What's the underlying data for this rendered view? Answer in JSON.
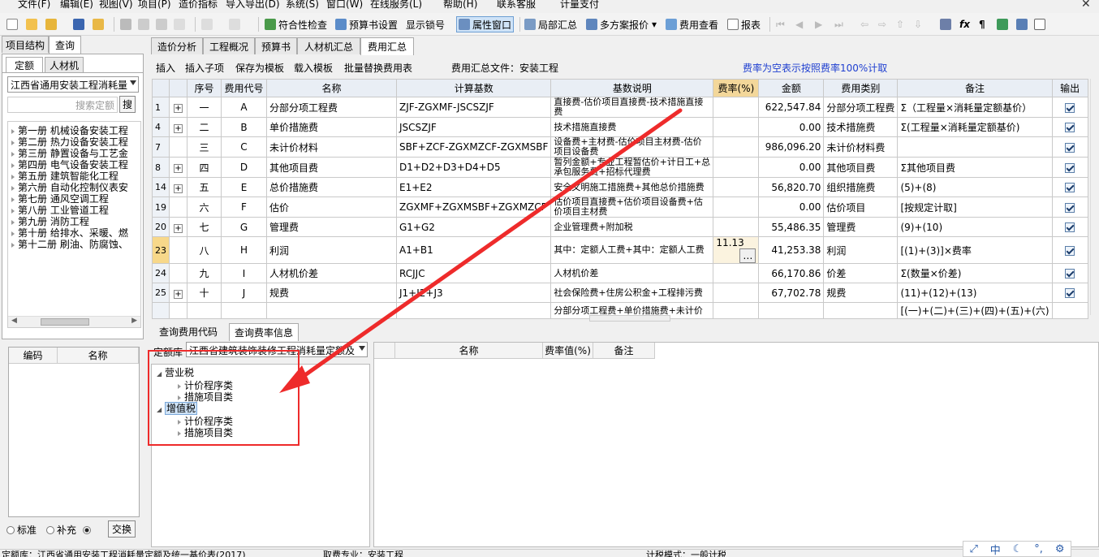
{
  "menu": [
    "文件(F)",
    "编辑(E)",
    "视图(V)",
    "项目(P)",
    "造价指标",
    "导入导出(D)",
    "系统(S)",
    "窗口(W)",
    "在线服务(L)",
    "帮助(H)",
    "联系客服",
    "计量支付"
  ],
  "toolbar": {
    "check": "符合性检查",
    "budget_settings": "预算书设置",
    "show_lock": "显示锁号",
    "property_window": "属性窗口",
    "local_summary": "局部汇总",
    "multi_quote": "多方案报价",
    "fee_view": "费用查看",
    "report": "报表"
  },
  "left": {
    "tabs": [
      "项目结构",
      "查询"
    ],
    "subtabs": [
      "定额",
      "人材机"
    ],
    "library": "江西省通用安装工程消耗量",
    "search_placeholder": "搜索定额",
    "search_btn": "搜",
    "volumes": [
      "第一册 机械设备安装工程",
      "第二册 热力设备安装工程",
      "第三册 静置设备与工艺金",
      "第四册 电气设备安装工程",
      "第五册 建筑智能化工程",
      "第六册 自动化控制仪表安",
      "第七册 通风空调工程",
      "第八册 工业管道工程",
      "第九册 消防工程",
      "第十册 给排水、采暖、燃",
      "第十二册 刷油、防腐蚀、"
    ],
    "grid_headers": [
      "编码",
      "名称"
    ],
    "radios": [
      "标准",
      "补充"
    ],
    "swap_btn": "交换"
  },
  "main": {
    "tabs": [
      "造价分析",
      "工程概况",
      "预算书",
      "人材机汇总",
      "费用汇总"
    ],
    "active_tab": "费用汇总",
    "subtoolbar": {
      "insert": "插入",
      "insert_child": "插入子项",
      "save_template": "保存为模板",
      "load_template": "载入模板",
      "batch_replace": "批量替换费用表",
      "file_label": "费用汇总文件：安装工程",
      "note": "费率为空表示按照费率100%计取"
    },
    "headers": [
      "序号",
      "费用代号",
      "名称",
      "计算基数",
      "基数说明",
      "费率(%)",
      "金额",
      "费用类别",
      "备注",
      "输出"
    ],
    "rows": [
      {
        "ln": "1",
        "exp": "+",
        "seq": "一",
        "code": "A",
        "name": "分部分项工程费",
        "base": "ZJF-ZGXMF-JSCSZJF",
        "desc": "直接费-估价项目直接费-技术措施直接费",
        "rate": "",
        "amount": "622,547.84",
        "cat": "分部分项工程费",
        "note": "Σ（工程量×消耗量定额基价）"
      },
      {
        "ln": "4",
        "exp": "+",
        "seq": "二",
        "code": "B",
        "name": "单价措施费",
        "base": "JSCSZJF",
        "desc": "技术措施直接费",
        "rate": "",
        "amount": "0.00",
        "cat": "技术措施费",
        "note": "Σ(工程量×消耗量定额基价)"
      },
      {
        "ln": "7",
        "exp": "",
        "seq": "三",
        "code": "C",
        "name": "未计价材料",
        "base": "SBF+ZCF-ZGXMZCF-ZGXMSBF",
        "desc": "设备费+主材费-估价项目主材费-估价项目设备费",
        "rate": "",
        "amount": "986,096.20",
        "cat": "未计价材料费",
        "note": ""
      },
      {
        "ln": "8",
        "exp": "+",
        "seq": "四",
        "code": "D",
        "name": "其他项目费",
        "base": "D1+D2+D3+D4+D5",
        "desc": "暂列金额+专业工程暂估价+计日工+总承包服务费+招标代理费",
        "rate": "",
        "amount": "0.00",
        "cat": "其他项目费",
        "note": "Σ其他项目费"
      },
      {
        "ln": "14",
        "exp": "+",
        "seq": "五",
        "code": "E",
        "name": "总价措施费",
        "base": "E1+E2",
        "desc": "安全文明施工措施费+其他总价措施费",
        "rate": "",
        "amount": "56,820.70",
        "cat": "组织措施费",
        "note": "(5)+(8)"
      },
      {
        "ln": "19",
        "exp": "",
        "seq": "六",
        "code": "F",
        "name": "估价",
        "base": "ZGXMF+ZGXMSBF+ZGXMZCF",
        "desc": "估价项目直接费+估价项目设备费+估价项目主材费",
        "rate": "",
        "amount": "0.00",
        "cat": "估价项目",
        "note": "[按规定计取]"
      },
      {
        "ln": "20",
        "exp": "+",
        "seq": "七",
        "code": "G",
        "name": "管理费",
        "base": "G1+G2",
        "desc": "企业管理费+附加税",
        "rate": "",
        "amount": "55,486.35",
        "cat": "管理费",
        "note": "(9)+(10)"
      },
      {
        "ln": "23",
        "exp": "",
        "seq": "八",
        "code": "H",
        "name": "利润",
        "base": "A1+B1",
        "desc": "其中：定额人工费+其中：定额人工费",
        "rate": "11.13",
        "amount": "41,253.38",
        "cat": "利润",
        "note": "[(1)+(3)]×费率"
      },
      {
        "ln": "24",
        "exp": "",
        "seq": "九",
        "code": "I",
        "name": "人材机价差",
        "base": "RCJJC",
        "desc": "人材机价差",
        "rate": "",
        "amount": "66,170.86",
        "cat": "价差",
        "note": "Σ(数量×价差)"
      },
      {
        "ln": "25",
        "exp": "+",
        "seq": "十",
        "code": "J",
        "name": "规费",
        "base": "J1+J2+J3",
        "desc": "社会保险费+住房公积金+工程排污费",
        "rate": "",
        "amount": "67,702.78",
        "cat": "规费",
        "note": "(11)+(12)+(13)"
      },
      {
        "ln": "",
        "exp": "",
        "seq": "",
        "code": "",
        "name": "",
        "base": "",
        "desc": "分部分项工程费+单价措施费+未计价",
        "rate": "",
        "amount": "",
        "cat": "",
        "note": "[(一)+(二)+(三)+(四)+(五)+(六)"
      }
    ]
  },
  "bottom": {
    "tabs": [
      "查询费用代码",
      "查询费率信息"
    ],
    "lib_label": "定额库",
    "lib_value": "江西省建筑装饰装修工程消耗量定额及",
    "tree": [
      {
        "label": "营业税",
        "children": [
          "计价程序类",
          "措施项目类"
        ]
      },
      {
        "label": "增值税",
        "children": [
          "计价程序类",
          "措施项目类"
        ]
      }
    ],
    "rate_headers": [
      "名称",
      "费率值(%)",
      "备注"
    ]
  },
  "status": {
    "quota_lib": "定额库：江西省通用安装工程消耗量定额及统一基价表(2017)",
    "fee_spec": "取费专业：安装工程",
    "tax_mode": "计税模式：一般计税"
  },
  "ime": {
    "lang": "中"
  }
}
